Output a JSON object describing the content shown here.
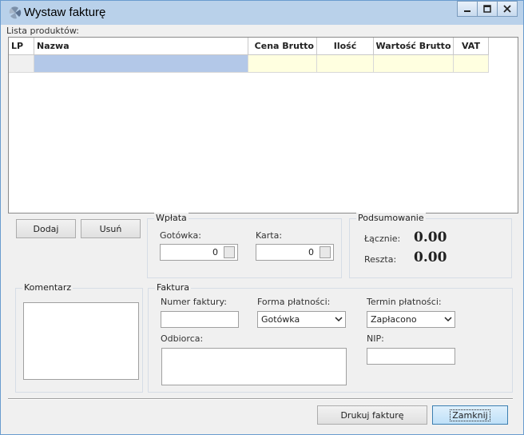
{
  "window": {
    "title": "Wystaw fakturę"
  },
  "products": {
    "label": "Lista produktów:",
    "columns": [
      "LP",
      "Nazwa",
      "Cena Brutto",
      "Ilość",
      "Wartość Brutto",
      "VAT"
    ]
  },
  "actions": {
    "add": "Dodaj",
    "remove": "Usuń"
  },
  "payment": {
    "title": "Wpłata",
    "cash_label": "Gotówka:",
    "cash_value": "0",
    "card_label": "Karta:",
    "card_value": "0"
  },
  "summary": {
    "title": "Podsumowanie",
    "total_label": "Łącznie:",
    "total_value": "0.00",
    "change_label": "Reszta:",
    "change_value": "0.00"
  },
  "comment": {
    "title": "Komentarz",
    "value": ""
  },
  "invoice": {
    "title": "Faktura",
    "number_label": "Numer faktury:",
    "number_value": "",
    "payment_form_label": "Forma płatności:",
    "payment_form_value": "Gotówka",
    "payment_term_label": "Termin płatności:",
    "payment_term_value": "Zapłacono",
    "recipient_label": "Odbiorca:",
    "recipient_value": "",
    "nip_label": "NIP:",
    "nip_value": ""
  },
  "footer": {
    "print": "Drukuj fakturę",
    "close": "Zamknij"
  },
  "colors": {
    "accent": "#b9d1ea",
    "selected_cell": "#b3c8e8",
    "editable_cell": "#ffffe0",
    "close_button": "#c8e4fa"
  }
}
